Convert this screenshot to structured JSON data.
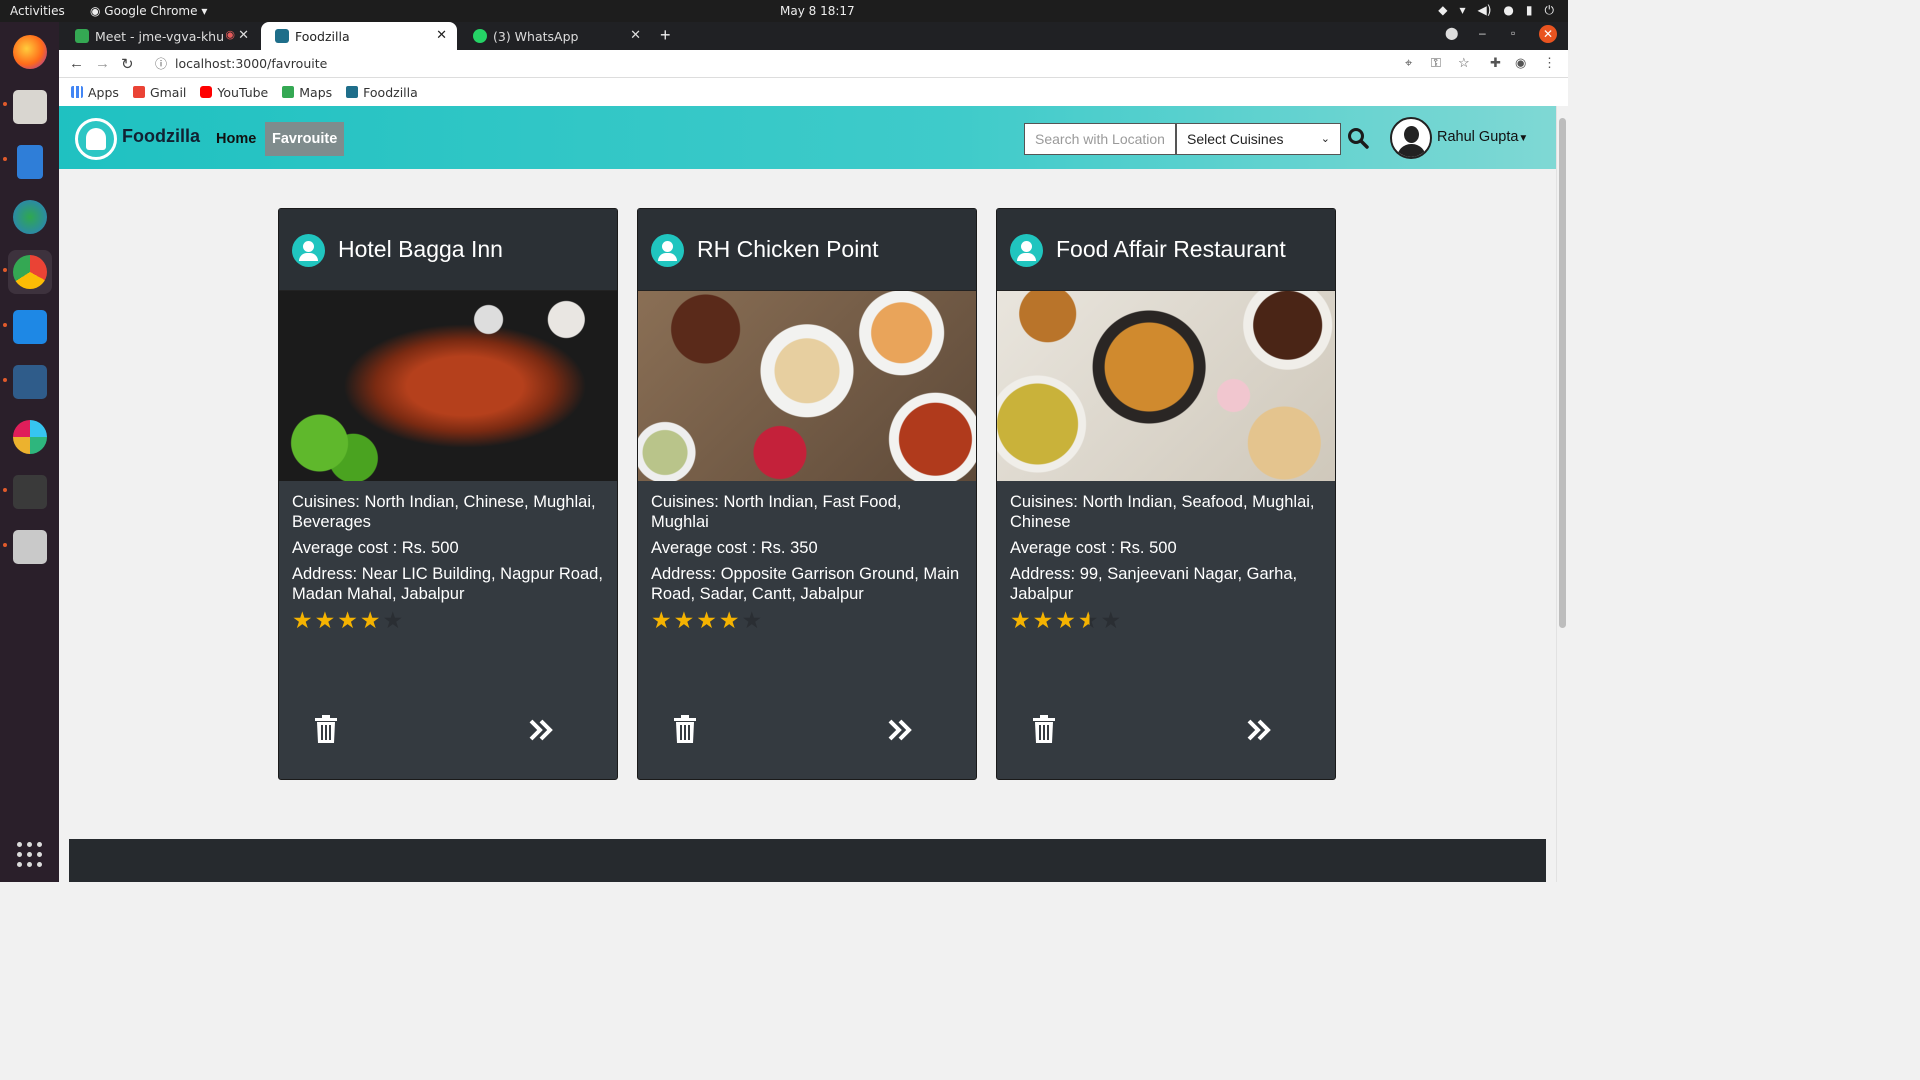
{
  "os": {
    "activities": "Activities",
    "app_name": "Google Chrome",
    "clock": "May 8  18:17"
  },
  "browser": {
    "tabs": [
      {
        "label": "Meet - jme-vgva-khu",
        "active": false
      },
      {
        "label": "Foodzilla",
        "active": true
      },
      {
        "label": "(3) WhatsApp",
        "active": false
      }
    ],
    "url": "localhost:3000/favrouite",
    "bookmarks": [
      "Apps",
      "Gmail",
      "YouTube",
      "Maps",
      "Foodzilla"
    ]
  },
  "site": {
    "brand": "Foodzilla",
    "nav": {
      "home": "Home",
      "favourite": "Favrouite"
    },
    "search_placeholder": "Search with Location",
    "cuisine_select": "Select Cuisines",
    "user": "Rahul Gupta"
  },
  "cards": [
    {
      "name": "Hotel Bagga Inn",
      "cuisines": "Cuisines: North Indian, Chinese, Mughlai, Beverages",
      "cost": "Average cost : Rs. 500",
      "address": "Address: Near LIC Building, Nagpur Road, Madan Mahal, Jabalpur",
      "rating": 4
    },
    {
      "name": "RH Chicken Point",
      "cuisines": "Cuisines: North Indian, Fast Food, Mughlai",
      "cost": "Average cost : Rs. 350",
      "address": "Address: Opposite Garrison Ground, Main Road, Sadar, Cantt, Jabalpur",
      "rating": 4
    },
    {
      "name": "Food Affair Restaurant",
      "cuisines": "Cuisines: North Indian, Seafood, Mughlai, Chinese",
      "cost": "Average cost : Rs. 500",
      "address": "Address: 99, Sanjeevani Nagar, Garha, Jabalpur",
      "rating": 3.5
    }
  ],
  "colors": {
    "teal": "#20c5bf",
    "card_bg": "#343a40",
    "star": "#f5b301"
  }
}
